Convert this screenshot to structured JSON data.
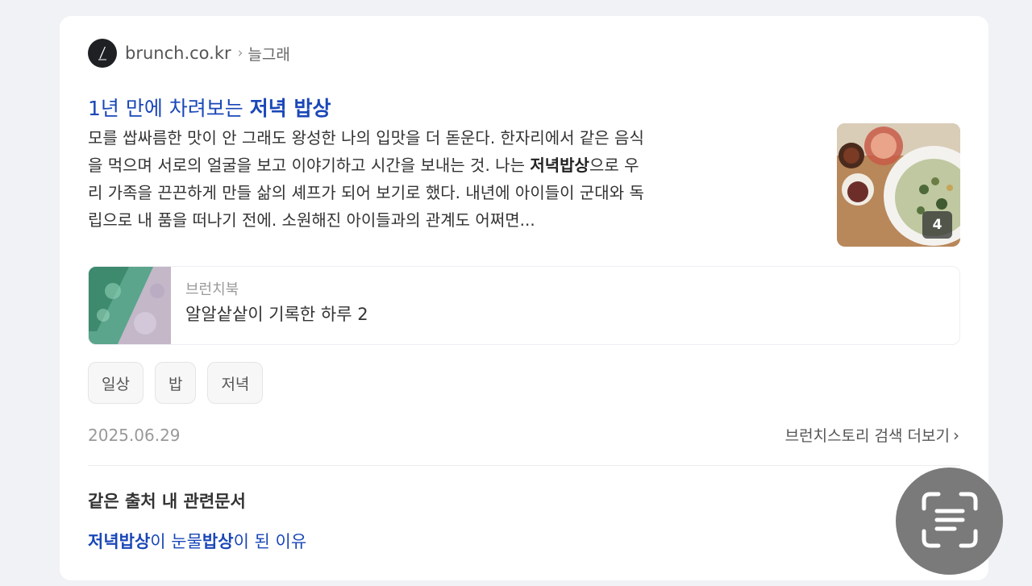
{
  "source": {
    "site_name": "brunch.co.kr",
    "breadcrumb_separator": "›",
    "breadcrumb": "늘그래",
    "favicon_icon": "brunch-pen-logo-icon"
  },
  "result": {
    "title_prefix": "1년 만에 차려보는 ",
    "title_highlight": "저녁 밥상",
    "snippet": {
      "line1": "모를 쌉싸름한 맛이 안 그래도 왕성한 나의 입맛을 더 돋운다. 한자리에서 같은 음식",
      "line2_before": "을 먹으며 서로의 얼굴을 보고 이야기하고 시간을 보내는 것. 나는 ",
      "line2_bold": "저녁밥상",
      "line2_after": "으로 우",
      "line3": "리 가족을 끈끈하게 만들 삶의 셰프가 되어 보기로 했다. 내년에 아이들이 군대와 독",
      "line4": "립으로 내 품을 떠나기 전에. 소원해진 아이들과의 관계도 어쩌면..."
    },
    "thumbnail_count": "4"
  },
  "related_book": {
    "label": "브런치북",
    "title": "알알샅샅이 기록한 하루 2"
  },
  "tags": [
    "일상",
    "밥",
    "저녁"
  ],
  "date": "2025.06.29",
  "more_link": {
    "label": "브런치스토리 검색 더보기",
    "chevron": "›"
  },
  "related_docs": {
    "section_title": "같은 출처 내 관련문서",
    "link": {
      "part1_bold": "저녁밥상",
      "part2": "이 ",
      "part3": "눈물",
      "part4_bold": "밥상",
      "part5": "이 된 이유"
    }
  },
  "colors": {
    "link_blue": "#1a47b8",
    "background": "#f1f2f5",
    "card": "#ffffff",
    "scan_button": "#7a7a7a"
  },
  "floating_button_icon": "text-scan-icon"
}
